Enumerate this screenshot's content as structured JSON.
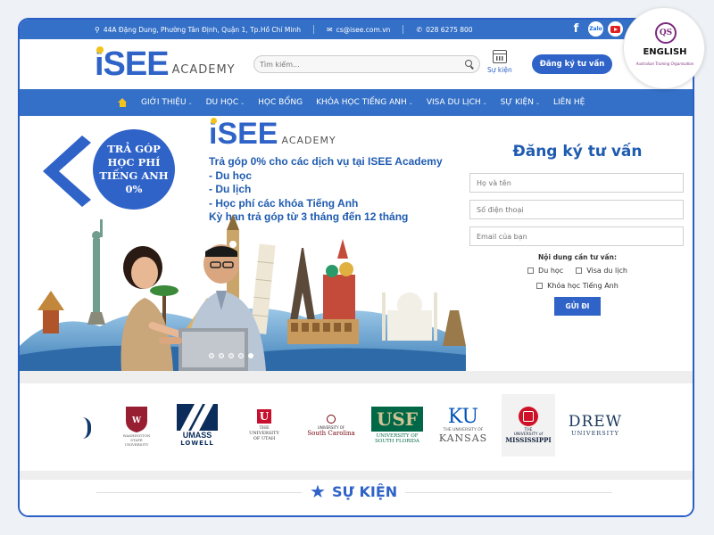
{
  "topbar": {
    "address": "44A Đặng Dung, Phường Tân Định, Quận 1, Tp.Hồ Chí Minh",
    "email": "cs@isee.com.vn",
    "phone": "028 6275 800",
    "social": [
      "facebook-icon",
      "zalo-icon",
      "youtube-icon"
    ],
    "zalo_label": "Zalo"
  },
  "header": {
    "logo_main": "iSEE",
    "logo_sub": "ACADEMY",
    "search_placeholder": "Tìm kiếm...",
    "events_label": "Sự kiện",
    "consult_button": "Đăng ký tư vấn"
  },
  "nav": {
    "items": [
      {
        "label": "GIỚI THIỆU",
        "dropdown": true
      },
      {
        "label": "DU HỌC",
        "dropdown": true
      },
      {
        "label": "HỌC BỔNG",
        "dropdown": false
      },
      {
        "label": "KHÓA HỌC TIẾNG ANH",
        "dropdown": true
      },
      {
        "label": "VISA DU LỊCH",
        "dropdown": true
      },
      {
        "label": "SỰ KIỆN",
        "dropdown": true
      },
      {
        "label": "LIÊN HỆ",
        "dropdown": false
      }
    ]
  },
  "hero": {
    "circle_lines": [
      "TRẢ GÓP",
      "HỌC PHÍ",
      "TIẾNG ANH",
      "0%"
    ],
    "logo_main": "iSEE",
    "logo_sub": "ACADEMY",
    "promo_lines": [
      "Trả góp 0% cho các dịch vụ tại ISEE Academy",
      "-   Du học",
      "-   Du lịch",
      "-   Học phí các khóa Tiếng Anh",
      "Kỳ hạn trả góp từ 3 tháng đến 12 tháng"
    ],
    "slides_total": 5,
    "slide_active": 1
  },
  "form": {
    "title": "Đăng ký tư vấn",
    "name_placeholder": "Họ và tên",
    "phone_placeholder": "Số điện thoại",
    "email_placeholder": "Email của bạn",
    "content_label": "Nội dung cần tư vấn:",
    "options": [
      "Du học",
      "Visa du lịch",
      "Khóa học Tiếng Anh"
    ],
    "submit": "GỬI ĐI"
  },
  "universities": {
    "wsu": [
      "WASHINGTON",
      "STATE",
      "UNIVERSITY"
    ],
    "umass": [
      "UMASS",
      "LOWELL"
    ],
    "utah": [
      "THE",
      "UNIVERSITY",
      "OF UTAH"
    ],
    "usc": [
      "UNIVERSITY OF",
      "South Carolina"
    ],
    "usf": [
      "USF",
      "UNIVERSITY OF",
      "SOUTH FLORIDA"
    ],
    "ku": [
      "KU",
      "THE UNIVERSITY OF",
      "KANSAS"
    ],
    "miss": [
      "THE",
      "UNIVERSITY of",
      "MISSISSIPPI"
    ],
    "drew": [
      "DREW",
      "UNIVERSITY"
    ]
  },
  "events_section": {
    "title": "SỰ KIỆN"
  },
  "badge": {
    "line1": "ENGLISH",
    "line2": "Australian Training Organisation",
    "monogram": "QS"
  },
  "colors": {
    "primary": "#3470c7",
    "dark_blue": "#1f5bb0",
    "accent_yellow": "#f3c31c"
  }
}
